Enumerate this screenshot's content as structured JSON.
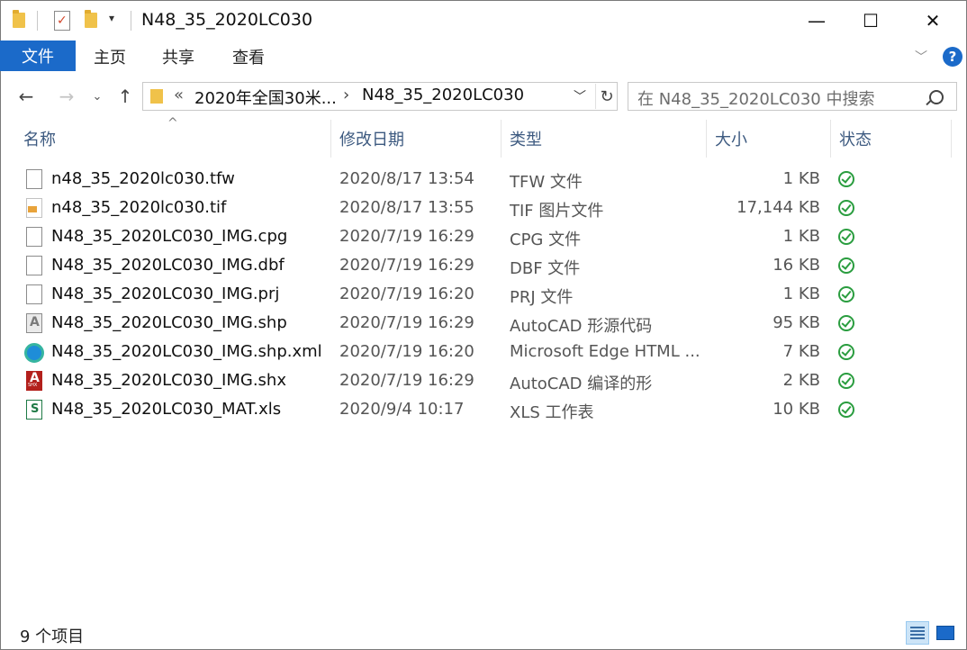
{
  "window": {
    "title": "N48_35_2020LC030"
  },
  "ribbon": {
    "tabs": [
      "文件",
      "主页",
      "共享",
      "查看"
    ]
  },
  "address": {
    "prefix": "«",
    "segments": [
      "2020年全国30米...",
      "N48_35_2020LC030"
    ]
  },
  "search": {
    "placeholder": "在 N48_35_2020LC030 中搜索"
  },
  "columns": {
    "name": "名称",
    "date": "修改日期",
    "type": "类型",
    "size": "大小",
    "status": "状态"
  },
  "files": [
    {
      "name": "n48_35_2020lc030.tfw",
      "date": "2020/8/17 13:54",
      "type": "TFW 文件",
      "size": "1 KB",
      "icon": "text-file-icon"
    },
    {
      "name": "n48_35_2020lc030.tif",
      "date": "2020/8/17 13:55",
      "type": "TIF 图片文件",
      "size": "17,144 KB",
      "icon": "image-file-icon"
    },
    {
      "name": "N48_35_2020LC030_IMG.cpg",
      "date": "2020/7/19 16:29",
      "type": "CPG 文件",
      "size": "1 KB",
      "icon": "text-file-icon"
    },
    {
      "name": "N48_35_2020LC030_IMG.dbf",
      "date": "2020/7/19 16:29",
      "type": "DBF 文件",
      "size": "16 KB",
      "icon": "text-file-icon"
    },
    {
      "name": "N48_35_2020LC030_IMG.prj",
      "date": "2020/7/19 16:20",
      "type": "PRJ 文件",
      "size": "1 KB",
      "icon": "text-file-icon"
    },
    {
      "name": "N48_35_2020LC030_IMG.shp",
      "date": "2020/7/19 16:29",
      "type": "AutoCAD 形源代码",
      "size": "95 KB",
      "icon": "autocad-shape-icon"
    },
    {
      "name": "N48_35_2020LC030_IMG.shp.xml",
      "date": "2020/7/19 16:20",
      "type": "Microsoft Edge HTML ...",
      "size": "7 KB",
      "icon": "edge-icon"
    },
    {
      "name": "N48_35_2020LC030_IMG.shx",
      "date": "2020/7/19 16:29",
      "type": "AutoCAD 编译的形",
      "size": "2 KB",
      "icon": "autocad-shx-icon"
    },
    {
      "name": "N48_35_2020LC030_MAT.xls",
      "date": "2020/9/4 10:17",
      "type": "XLS 工作表",
      "size": "10 KB",
      "icon": "spreadsheet-icon"
    }
  ],
  "statusbar": {
    "count": "9 个项目"
  },
  "colors": {
    "accent": "#1b6ac9",
    "status_ok": "#2a9d3f",
    "header_text": "#3d5a80"
  }
}
